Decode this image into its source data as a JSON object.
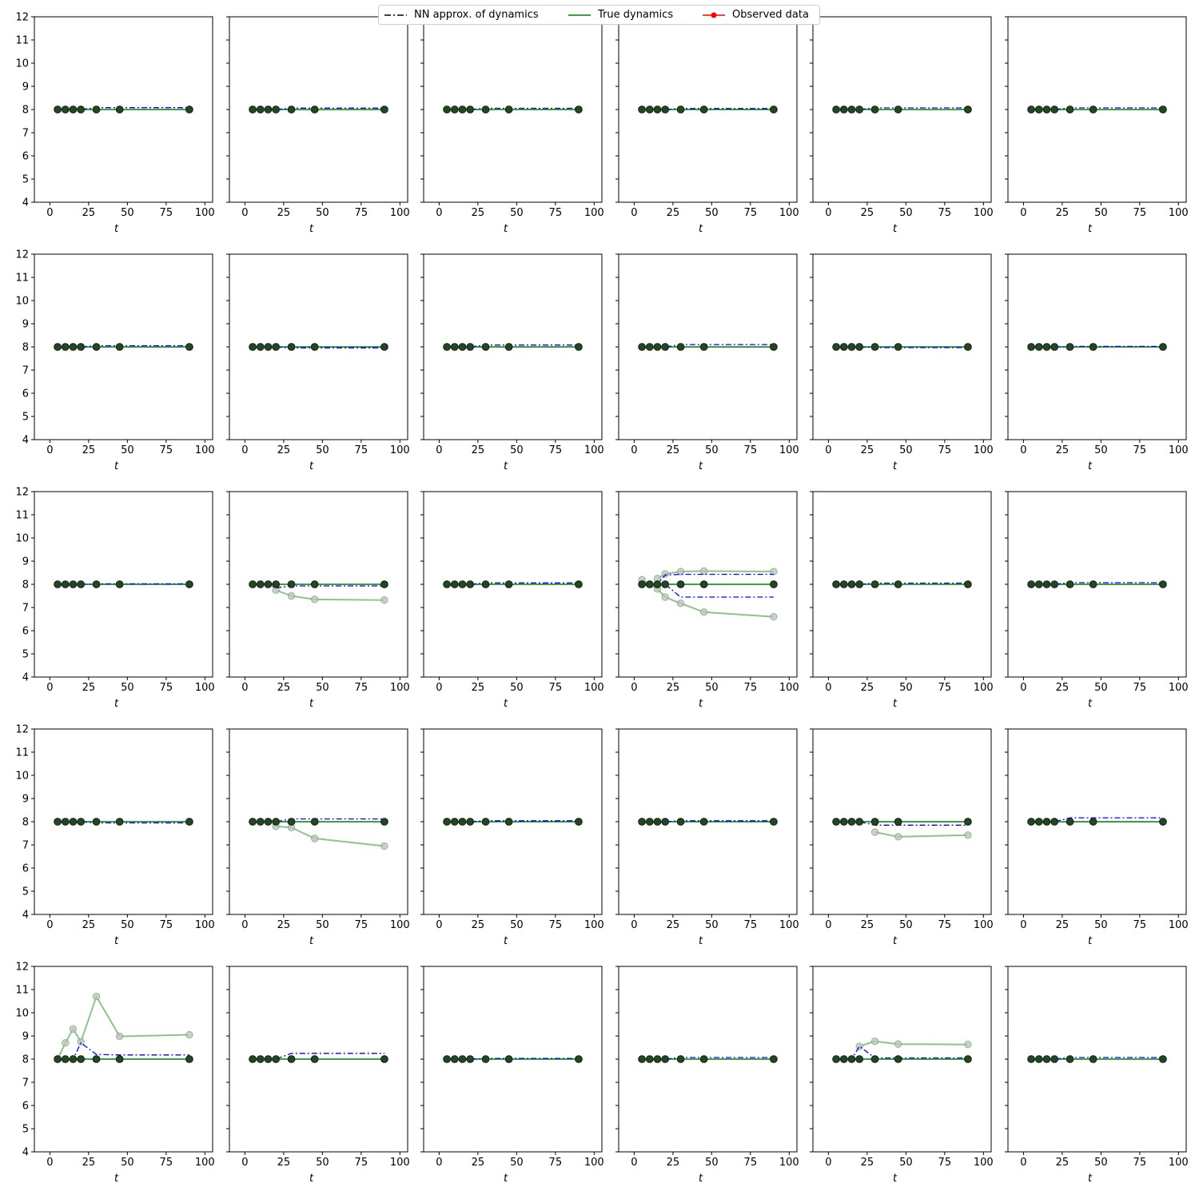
{
  "legend": {
    "items": [
      {
        "label": "NN approx. of dynamics",
        "color": "#000000",
        "style": "dashdot"
      },
      {
        "label": "True dynamics",
        "color": "#008000",
        "style": "solid"
      },
      {
        "label": "Observed data",
        "color": "#ff0000",
        "style": "solid-marker"
      }
    ]
  },
  "chart_data": {
    "type": "line",
    "layout": "5x6 grid of subplots",
    "x_label": "t",
    "xlim": [
      -10,
      105
    ],
    "ylim": [
      4,
      12
    ],
    "x_ticks": [
      0,
      25,
      50,
      75,
      100
    ],
    "y_ticks": [
      4,
      5,
      6,
      7,
      8,
      9,
      10,
      11,
      12
    ],
    "t": [
      5,
      10,
      15,
      20,
      30,
      45,
      90
    ],
    "true_value": 8,
    "colors": {
      "nn": "#0000ff",
      "true": "#008000",
      "marker": "#222222",
      "observed_alt": "#77bb77"
    },
    "panels": [
      {
        "nn": [
          8,
          8,
          8,
          8,
          8.08,
          8.08,
          8.08
        ],
        "observed_alt": null
      },
      {
        "nn": [
          8,
          8,
          8,
          8,
          8.06,
          8.06,
          8.06
        ],
        "observed_alt": null
      },
      {
        "nn": [
          8,
          8,
          8,
          8,
          8.05,
          8.05,
          8.05
        ],
        "observed_alt": null
      },
      {
        "nn": [
          8,
          8,
          8,
          8,
          8.04,
          8.04,
          8.04
        ],
        "observed_alt": null
      },
      {
        "nn": [
          8,
          8,
          8,
          8,
          8.07,
          8.07,
          8.07
        ],
        "observed_alt": null
      },
      {
        "nn": [
          8,
          8,
          8,
          8,
          8.07,
          8.07,
          8.07
        ],
        "observed_alt": null
      },
      {
        "nn": [
          8,
          8,
          8,
          8,
          8.05,
          8.05,
          8.05
        ],
        "observed_alt": null
      },
      {
        "nn": [
          8,
          8,
          8,
          8,
          7.96,
          7.96,
          7.96
        ],
        "observed_alt": null
      },
      {
        "nn": [
          8,
          8,
          8,
          8,
          8.08,
          8.08,
          8.08
        ],
        "observed_alt": null
      },
      {
        "nn": [
          8,
          8,
          8,
          8,
          8.1,
          8.1,
          8.1
        ],
        "observed_alt": null
      },
      {
        "nn": [
          8,
          8,
          8,
          8,
          7.97,
          7.97,
          7.97
        ],
        "observed_alt": null
      },
      {
        "nn": [
          8,
          8,
          8,
          8,
          8.02,
          8.02,
          8.02
        ],
        "observed_alt": null
      },
      {
        "nn": [
          8,
          8,
          8,
          8,
          8.02,
          8.02,
          8.02
        ],
        "observed_alt": null
      },
      {
        "nn": [
          8,
          8,
          8,
          7.85,
          7.93,
          7.93,
          7.93
        ],
        "observed_alt": [
          [
            20,
            7.75
          ],
          [
            30,
            7.5
          ],
          [
            45,
            7.35
          ],
          [
            90,
            7.32
          ]
        ]
      },
      {
        "nn": [
          8,
          8,
          8,
          8,
          8.06,
          8.06,
          8.06
        ],
        "observed_alt": null
      },
      {
        "nn": [
          8,
          8,
          8,
          8,
          7.45,
          7.45,
          7.45
        ],
        "nn_upper": [
          8,
          8,
          8,
          8.4,
          8.43,
          8.43,
          8.43
        ],
        "observed_alt": [
          [
            5,
            8.2
          ],
          [
            10,
            8.0
          ],
          [
            15,
            7.8
          ],
          [
            20,
            7.45
          ],
          [
            30,
            7.18
          ],
          [
            45,
            6.8
          ],
          [
            90,
            6.6
          ]
        ],
        "observed_alt_upper": [
          [
            15,
            8.25
          ],
          [
            20,
            8.45
          ],
          [
            30,
            8.55
          ],
          [
            45,
            8.57
          ],
          [
            90,
            8.55
          ]
        ]
      },
      {
        "nn": [
          8,
          8,
          8,
          8,
          8.05,
          8.05,
          8.05
        ],
        "observed_alt": null
      },
      {
        "nn": [
          8,
          8,
          8,
          8,
          8.07,
          8.07,
          8.07
        ],
        "observed_alt": null
      },
      {
        "nn": [
          8,
          8,
          8,
          8,
          7.95,
          7.95,
          7.95
        ],
        "observed_alt": null
      },
      {
        "nn": [
          8,
          8,
          8,
          8,
          8.12,
          8.12,
          8.12
        ],
        "observed_alt": [
          [
            20,
            7.8
          ],
          [
            30,
            7.75
          ],
          [
            45,
            7.28
          ],
          [
            90,
            6.95
          ]
        ]
      },
      {
        "nn": [
          8,
          8,
          8,
          8,
          8.04,
          8.04,
          8.04
        ],
        "observed_alt": null
      },
      {
        "nn": [
          8,
          8,
          8,
          8,
          8.04,
          8.04,
          8.04
        ],
        "observed_alt": null
      },
      {
        "nn": [
          8,
          8,
          8,
          8,
          7.85,
          7.85,
          7.85
        ],
        "observed_alt": [
          [
            30,
            7.55
          ],
          [
            45,
            7.35
          ],
          [
            90,
            7.42
          ]
        ]
      },
      {
        "nn": [
          8,
          8,
          8,
          8,
          8.17,
          8.17,
          8.17
        ],
        "observed_alt": null
      },
      {
        "nn": [
          8,
          8,
          8,
          8.7,
          8.2,
          8.18,
          8.18
        ],
        "observed_alt": [
          [
            5,
            8.0
          ],
          [
            10,
            8.7
          ],
          [
            15,
            9.3
          ],
          [
            20,
            8.75
          ],
          [
            30,
            10.7
          ],
          [
            45,
            8.98
          ],
          [
            90,
            9.05
          ]
        ]
      },
      {
        "nn": [
          8,
          8,
          8,
          8,
          8.25,
          8.25,
          8.25
        ],
        "observed_alt": null
      },
      {
        "nn": [
          8,
          8,
          8,
          8,
          8.03,
          8.03,
          8.03
        ],
        "observed_alt": null
      },
      {
        "nn": [
          8,
          8,
          8,
          8,
          8.07,
          8.07,
          8.07
        ],
        "observed_alt": null
      },
      {
        "nn": [
          8,
          8,
          8,
          8.55,
          8.05,
          8.05,
          8.05
        ],
        "observed_alt": [
          [
            20,
            8.55
          ],
          [
            30,
            8.77
          ],
          [
            45,
            8.65
          ],
          [
            90,
            8.63
          ]
        ]
      },
      {
        "nn": [
          8,
          8,
          8,
          8,
          8.07,
          8.07,
          8.07
        ],
        "observed_alt": null
      }
    ]
  }
}
